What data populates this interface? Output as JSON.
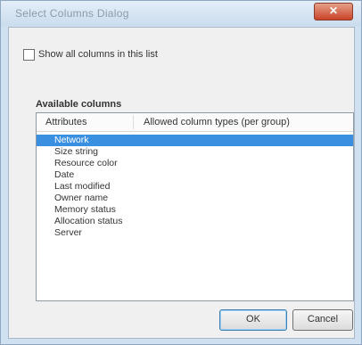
{
  "window": {
    "title": "Select Columns Dialog",
    "close_label": "✕"
  },
  "checkbox": {
    "label": "Show all columns in this list",
    "checked": false
  },
  "group": {
    "label": "Available columns"
  },
  "listview": {
    "columns": [
      "Attributes",
      "Allowed column types (per group)"
    ],
    "rows": [
      {
        "label": "Network",
        "selected": true
      },
      {
        "label": "Size string",
        "selected": false
      },
      {
        "label": "Resource color",
        "selected": false
      },
      {
        "label": "Date",
        "selected": false
      },
      {
        "label": "Last modified",
        "selected": false
      },
      {
        "label": "Owner name",
        "selected": false
      },
      {
        "label": "Memory status",
        "selected": false
      },
      {
        "label": "Allocation status",
        "selected": false
      },
      {
        "label": "Server",
        "selected": false
      }
    ]
  },
  "buttons": {
    "ok": "OK",
    "cancel": "Cancel"
  }
}
